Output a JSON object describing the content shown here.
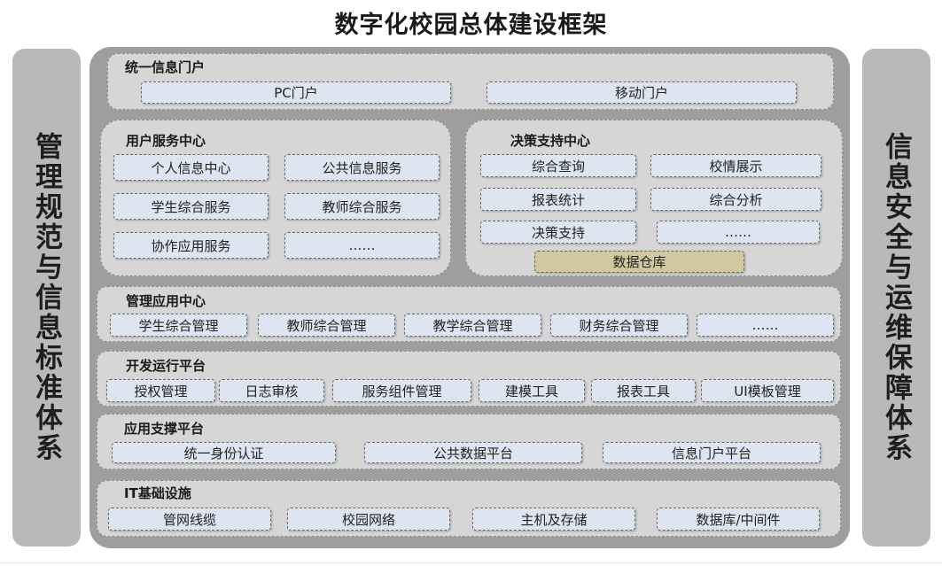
{
  "title": "数字化校园总体建设框架",
  "left_label": "管理规范与信息标准体系",
  "right_label": "信息安全与运维保障体系",
  "portal": {
    "title": "统一信息门户",
    "items": [
      "PC门户",
      "移动门户"
    ]
  },
  "user_service": {
    "title": "用户服务中心",
    "items": [
      "个人信息中心",
      "公共信息服务",
      "学生综合服务",
      "教师综合服务",
      "协作应用服务",
      "……"
    ]
  },
  "decision": {
    "title": "决策支持中心",
    "items": [
      "综合查询",
      "校情展示",
      "报表统计",
      "综合分析",
      "决策支持",
      "……"
    ],
    "warehouse": "数据仓库"
  },
  "management": {
    "title": "管理应用中心",
    "items": [
      "学生综合管理",
      "教师综合管理",
      "教学综合管理",
      "财务综合管理",
      "……"
    ]
  },
  "dev_platform": {
    "title": "开发运行平台",
    "items": [
      "授权管理",
      "日志审核",
      "服务组件管理",
      "建模工具",
      "报表工具",
      "UI模板管理"
    ]
  },
  "app_support": {
    "title": "应用支撑平台",
    "items": [
      "统一身份认证",
      "公共数据平台",
      "信息门户平台"
    ]
  },
  "infra": {
    "title": "IT基础设施",
    "items": [
      "管网线缆",
      "校园网络",
      "主机及存储",
      "数据库/中间件"
    ]
  },
  "colors": {
    "frame": "#9e9e9e",
    "panel": "#d6d6d6",
    "box": "#dde5f0",
    "warehouse": "#d2c8a0",
    "side": "#b9b9b9"
  }
}
